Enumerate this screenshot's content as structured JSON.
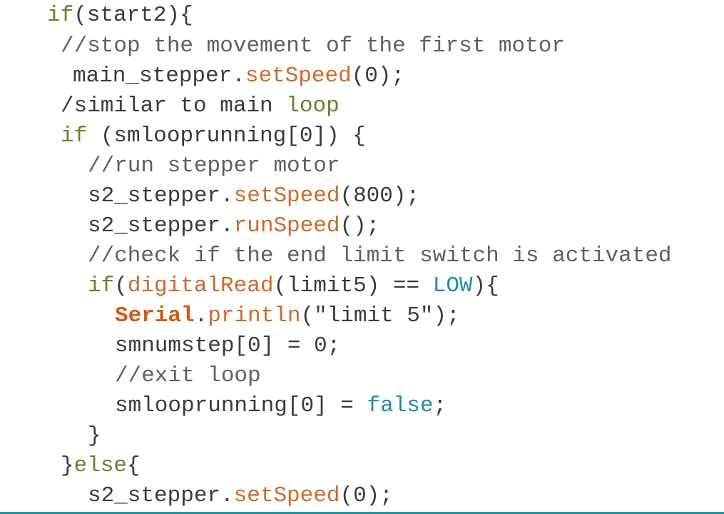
{
  "editor": {
    "accent_color": "#1f9aa8",
    "colors": {
      "plain": "#3b3b3b",
      "keyword": "#6b7f2e",
      "comment": "#5a6266",
      "function": "#cf6a29",
      "constant": "#1f8ea3",
      "class": "#cf5b14"
    },
    "lines": [
      {
        "tokens": [
          {
            "t": "if",
            "k": "keyword"
          },
          {
            "t": "(start2){",
            "k": "plain"
          }
        ]
      },
      {
        "tokens": [
          {
            "t": "//stop the movement of the first motor",
            "k": "comment"
          }
        ]
      },
      {
        "tokens": [
          {
            "t": "main_stepper.",
            "k": "plain"
          },
          {
            "t": "setSpeed",
            "k": "func"
          },
          {
            "t": "(0);",
            "k": "plain"
          }
        ]
      },
      {
        "tokens": [
          {
            "t": "/similar to main ",
            "k": "plain"
          },
          {
            "t": "loop",
            "k": "keyword"
          }
        ]
      },
      {
        "tokens": [
          {
            "t": "if",
            "k": "keyword"
          },
          {
            "t": " (smlooprunning[0]) {",
            "k": "plain"
          }
        ]
      },
      {
        "tokens": [
          {
            "t": "//run stepper motor",
            "k": "comment"
          }
        ]
      },
      {
        "tokens": [
          {
            "t": "s2_stepper.",
            "k": "plain"
          },
          {
            "t": "setSpeed",
            "k": "func"
          },
          {
            "t": "(800);",
            "k": "plain"
          }
        ]
      },
      {
        "tokens": [
          {
            "t": "s2_stepper.",
            "k": "plain"
          },
          {
            "t": "runSpeed",
            "k": "func"
          },
          {
            "t": "();",
            "k": "plain"
          }
        ]
      },
      {
        "tokens": [
          {
            "t": "//check if the end limit switch is activated",
            "k": "comment"
          }
        ]
      },
      {
        "tokens": [
          {
            "t": "if",
            "k": "keyword"
          },
          {
            "t": "(",
            "k": "plain"
          },
          {
            "t": "digitalRead",
            "k": "func"
          },
          {
            "t": "(limit5) == ",
            "k": "plain"
          },
          {
            "t": "LOW",
            "k": "const"
          },
          {
            "t": "){",
            "k": "plain"
          }
        ]
      },
      {
        "tokens": [
          {
            "t": "Serial",
            "k": "class"
          },
          {
            "t": ".",
            "k": "plain"
          },
          {
            "t": "println",
            "k": "func"
          },
          {
            "t": "(\"limit 5\");",
            "k": "plain"
          }
        ]
      },
      {
        "tokens": [
          {
            "t": "smnumstep[0] = 0;",
            "k": "plain"
          }
        ]
      },
      {
        "tokens": [
          {
            "t": "//exit loop",
            "k": "comment"
          }
        ]
      },
      {
        "tokens": [
          {
            "t": "smlooprunning[0] = ",
            "k": "plain"
          },
          {
            "t": "false",
            "k": "const"
          },
          {
            "t": ";",
            "k": "plain"
          }
        ]
      },
      {
        "tokens": [
          {
            "t": "}",
            "k": "plain"
          }
        ]
      },
      {
        "tokens": [
          {
            "t": "}",
            "k": "plain"
          },
          {
            "t": "else",
            "k": "keyword"
          },
          {
            "t": "{",
            "k": "plain"
          }
        ]
      },
      {
        "tokens": [
          {
            "t": "s2_stepper.",
            "k": "plain"
          },
          {
            "t": "setSpeed",
            "k": "func"
          },
          {
            "t": "(0);",
            "k": "plain"
          }
        ]
      }
    ]
  }
}
